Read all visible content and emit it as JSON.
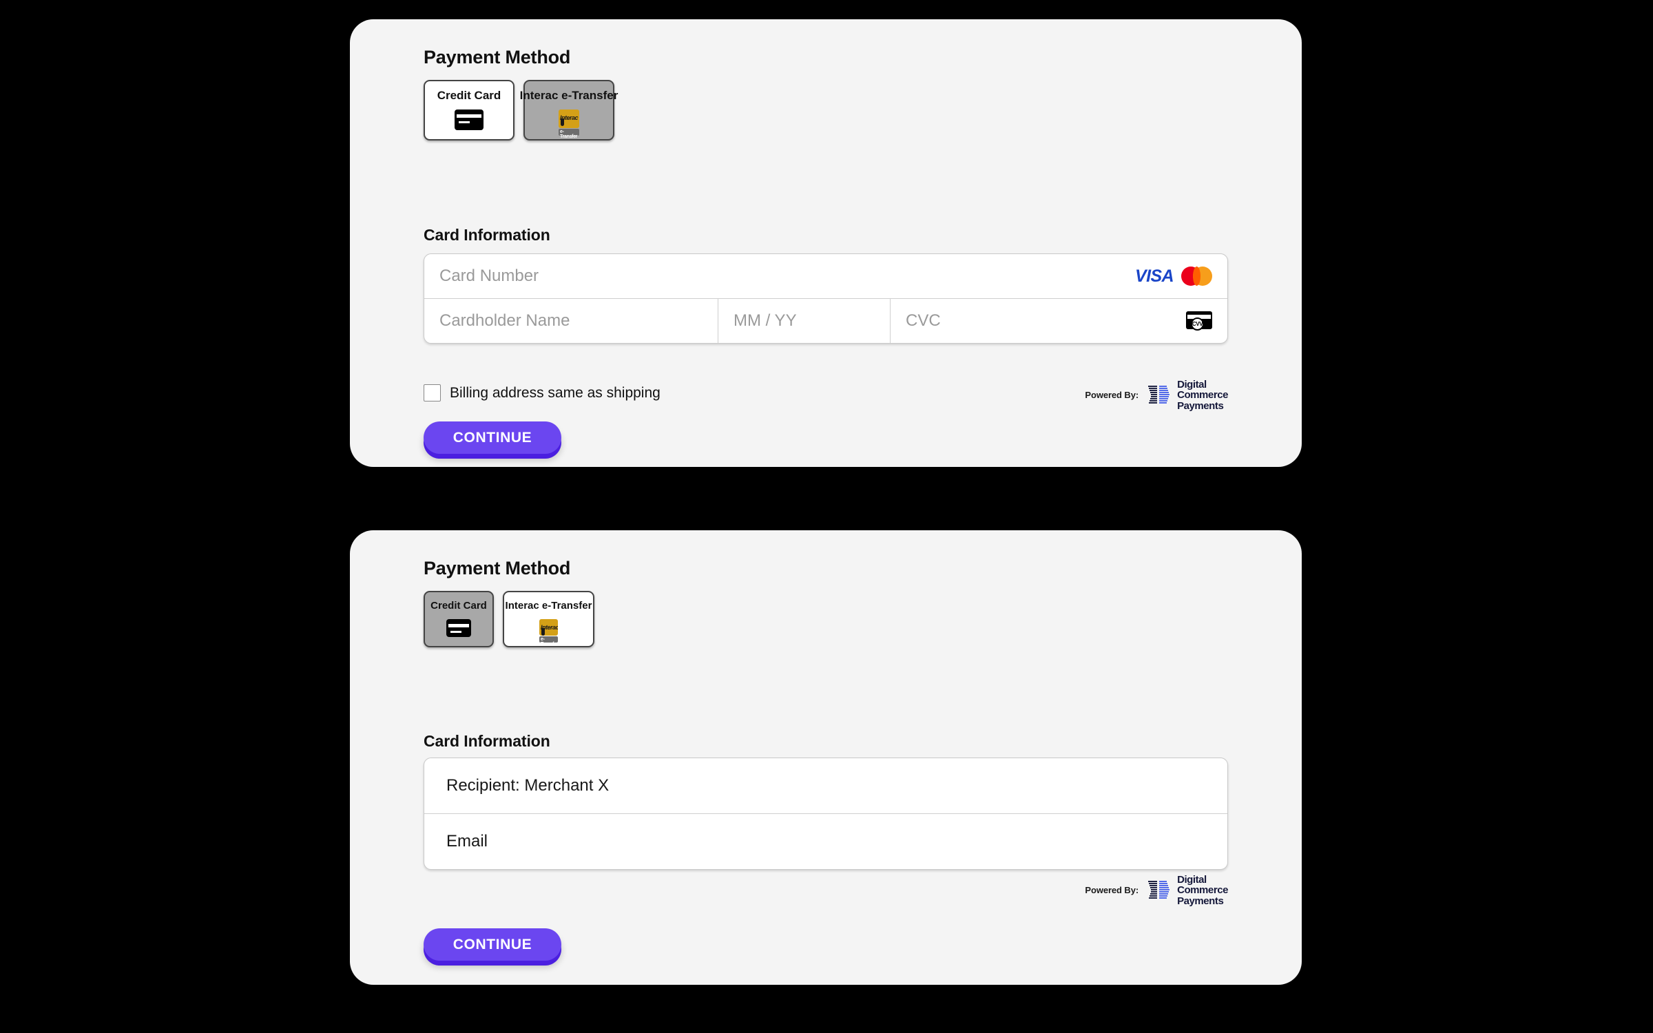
{
  "canvas": {
    "background_color": "#000000",
    "card_background_color": "#f4f4f4",
    "accent_color": "#6b46f0",
    "accent_shadow_color": "#4b1fe0",
    "selected_tile_color": "#a8a8a8"
  },
  "card_one": {
    "heading": "Payment Method",
    "methods": [
      {
        "label": "Credit Card",
        "icon": "credit-card-icon",
        "selected": false
      },
      {
        "label": "Interac e-Transfer",
        "icon": "interac-e-transfer-icon",
        "selected": true
      }
    ],
    "section_label": "Card Information",
    "fields": {
      "card_number_placeholder": "Card Number",
      "cardholder_name_placeholder": "Cardholder Name",
      "expiry_placeholder": "MM / YY",
      "cvc_placeholder": "CVC"
    },
    "brand_marks": {
      "visa": "VISA",
      "visa_color": "#1a45c8",
      "mastercard_red": "#eb001b",
      "mastercard_yellow": "#f79e1b",
      "cvv_badge": "CVV"
    },
    "billing_checkbox": {
      "label": "Billing address same as shipping",
      "checked": false
    },
    "powered_by": {
      "prefix": "Powered By:",
      "brand_line_1": "Digital",
      "brand_line_2": "Commerce",
      "brand_line_3": "Payments"
    },
    "continue_label": "CONTINUE"
  },
  "card_two": {
    "heading": "Payment Method",
    "methods": [
      {
        "label": "Credit Card",
        "icon": "credit-card-icon",
        "selected": true
      },
      {
        "label": "Interac e-Transfer",
        "icon": "interac-e-transfer-icon",
        "selected": false
      }
    ],
    "section_label": "Card Information",
    "fields": {
      "recipient_value": "Recipient: Merchant X",
      "email_value": "Email"
    },
    "powered_by": {
      "prefix": "Powered By:",
      "brand_line_1": "Digital",
      "brand_line_2": "Commerce",
      "brand_line_3": "Payments"
    },
    "continue_label": "CONTINUE"
  },
  "interac_logo": {
    "word": "Interac",
    "sub": "e-Transfer",
    "gold": "#d4a017"
  }
}
